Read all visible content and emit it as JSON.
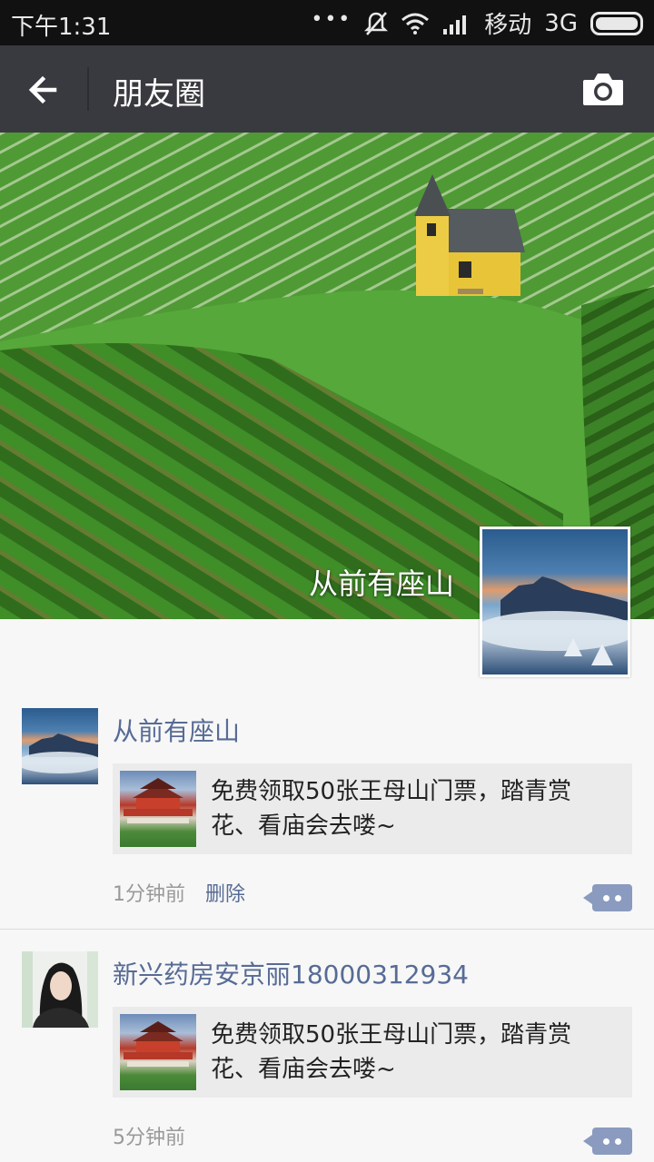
{
  "status_bar": {
    "time": "下午1:31",
    "dots": "•••",
    "carrier": "移动",
    "network": "3G",
    "icons": [
      "mute-bell-icon",
      "wifi-icon",
      "signal-icon",
      "battery-icon"
    ]
  },
  "toolbar": {
    "title": "朋友圈",
    "back_icon": "arrow-left-icon",
    "camera_icon": "camera-icon"
  },
  "cover": {
    "name": "从前有座山"
  },
  "posts": [
    {
      "author": "从前有座山",
      "text": "免费领取50张王母山门票，踏青赏花、看庙会去喽~",
      "time": "1分钟前",
      "delete_label": "删除"
    },
    {
      "author": "新兴药房安京丽18000312934",
      "text": "免费领取50张王母山门票，踏青赏花、看庙会去喽~",
      "time": "5分钟前",
      "delete_label": ""
    }
  ],
  "colors": {
    "toolbar_bg": "#393a3f",
    "link_blue": "#576b95",
    "page_bg": "#f7f7f7",
    "card_bg": "#ebebeb"
  }
}
